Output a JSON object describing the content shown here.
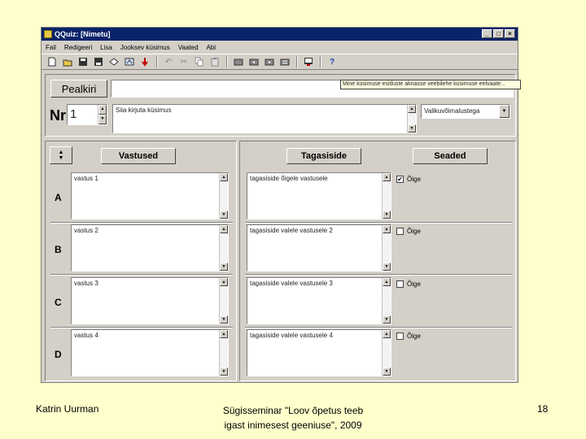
{
  "window": {
    "title": "QQuiz: [Nimetu]",
    "controls": {
      "minimize": "_",
      "maximize": "□",
      "close": "×"
    }
  },
  "menu": [
    "Fail",
    "Redigeeri",
    "Lisa",
    "Jooksev küsimus",
    "Vaated",
    "Abi"
  ],
  "toolbar": {
    "group1": [
      "new-icon",
      "open-icon",
      "save-icon",
      "save-as-icon",
      "preview-icon",
      "export-icon",
      "delete-icon"
    ],
    "group2": [
      "undo-icon",
      "cut-icon",
      "copy-icon",
      "paste-icon"
    ],
    "group3": [
      "first-question-icon",
      "previous-question-icon",
      "next-question-icon",
      "last-question-icon"
    ],
    "group4": [
      "display-icon"
    ],
    "group5": [
      "help-icon"
    ]
  },
  "header": {
    "pealkiri_label": "Pealkiri",
    "title_value": "",
    "hint_text": "Mine küsimuse esitluste aknasse veebilehe küsimuse eelvaate...",
    "nr_label": "Nr",
    "question_number": "1",
    "question_text": "Siia kirjuta küsimus",
    "question_type": "Valikuvõimalustega"
  },
  "answers": {
    "vastused_label": "Vastused",
    "tagasiside_label": "Tagasiside",
    "seaded_label": "Seaded",
    "items": [
      {
        "letter": "A",
        "answer": "vastus 1",
        "feedback": "tagasiside õigele vastusele",
        "correct_label": "Õige",
        "checkmark": "✔"
      },
      {
        "letter": "B",
        "answer": "vastus 2",
        "feedback": "tagasiside valele vastusele 2",
        "correct_label": "Õige",
        "checkmark": ""
      },
      {
        "letter": "C",
        "answer": "vastus 3",
        "feedback": "tagasiside valele vastusele 3",
        "correct_label": "Õige",
        "checkmark": ""
      },
      {
        "letter": "D",
        "answer": "vastus 4",
        "feedback": "tagasiside valele vastusele 4",
        "correct_label": "Õige",
        "checkmark": ""
      }
    ]
  },
  "footer": {
    "author": "Katrin Uurman",
    "seminar_line1": "Sügisseminar \"Loov õpetus teeb",
    "seminar_line2": "igast inimesest geeniuse\", 2009",
    "page": "18"
  },
  "colors": {
    "slide_bg": "#ffffcc",
    "window_bg": "#d4d0c8",
    "titlebar": "#0a246a"
  }
}
